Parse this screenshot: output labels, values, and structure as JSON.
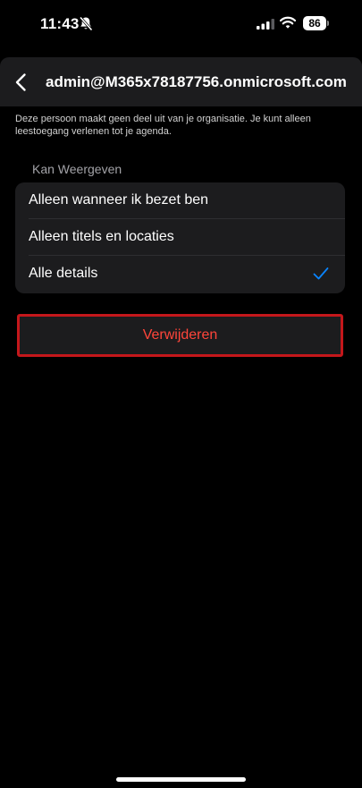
{
  "status_bar": {
    "time": "11:43",
    "battery": "86",
    "icons": [
      "bell-slash-icon",
      "signal-icon",
      "wifi-icon",
      "battery-icon"
    ]
  },
  "nav": {
    "title": "admin@M365x78187756.onmicrosoft.com",
    "back_icon": "chevron-left-icon"
  },
  "info_text": "Deze persoon maakt geen deel uit van je organisatie. Je kunt alleen leestoegang verlenen tot je agenda.",
  "section": {
    "header": "Kan Weergeven",
    "options": [
      {
        "label": "Alleen wanneer ik bezet ben",
        "selected": false
      },
      {
        "label": "Alleen titels en locaties",
        "selected": false
      },
      {
        "label": "Alle details",
        "selected": true
      }
    ]
  },
  "delete_label": "Verwijderen",
  "colors": {
    "background": "#000000",
    "cell_background": "#1c1c1e",
    "accent_blue": "#0a84ff",
    "destructive_red": "#ff453a",
    "highlight_border": "#c4171b"
  }
}
